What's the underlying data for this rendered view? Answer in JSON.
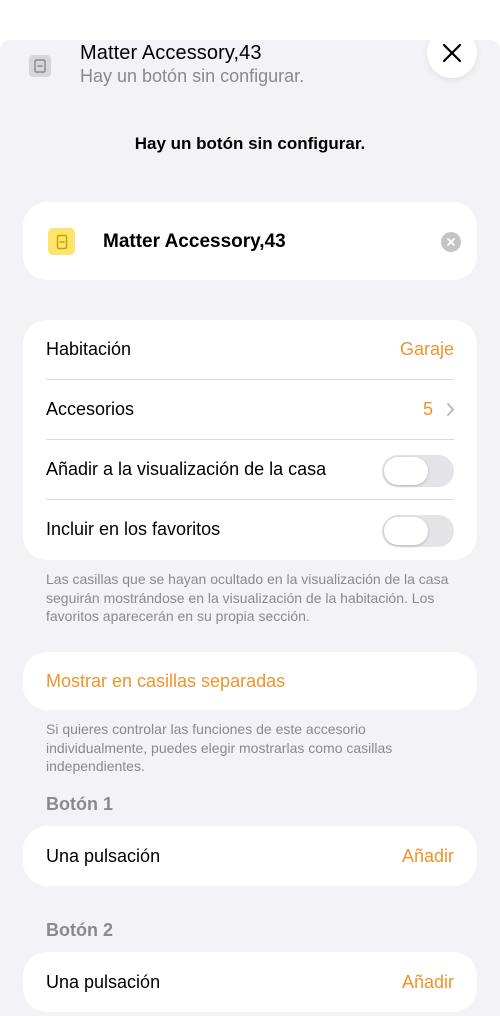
{
  "header": {
    "title": "Matter Accessory,43",
    "subtitle": "Hay un botón sin configurar.",
    "close_icon": "close-icon"
  },
  "section_heading": "Hay un botón sin configurar.",
  "name_field": {
    "value": "Matter Accessory,43",
    "icon": "switch-icon",
    "icon_color": "#fde46a"
  },
  "settings": {
    "rows": [
      {
        "label": "Habitación",
        "value": "Garaje"
      },
      {
        "label": "Accesorios",
        "value": "5"
      },
      {
        "label": "Añadir a la visualización de la casa",
        "toggle_on": false
      },
      {
        "label": "Incluir en los favoritos",
        "toggle_on": false
      }
    ],
    "footnote": "Las casillas que se hayan ocultado en la visualización de la casa seguirán mostrándose en la visualización de la habitación. Los favoritos aparecerán en su propia sección."
  },
  "separate_tiles": {
    "label": "Mostrar en casillas separadas",
    "footnote": "Si quieres controlar las funciones de este accesorio individualmente, puedes elegir mostrarlas como casillas independientes."
  },
  "buttons": [
    {
      "title": "Botón 1",
      "action_label": "Una pulsación",
      "add_label": "Añadir"
    },
    {
      "title": "Botón 2",
      "action_label": "Una pulsación",
      "add_label": "Añadir"
    }
  ],
  "colors": {
    "accent": "#f0932b",
    "background": "#f2f2f7",
    "secondary_text": "#8a8a8e"
  }
}
